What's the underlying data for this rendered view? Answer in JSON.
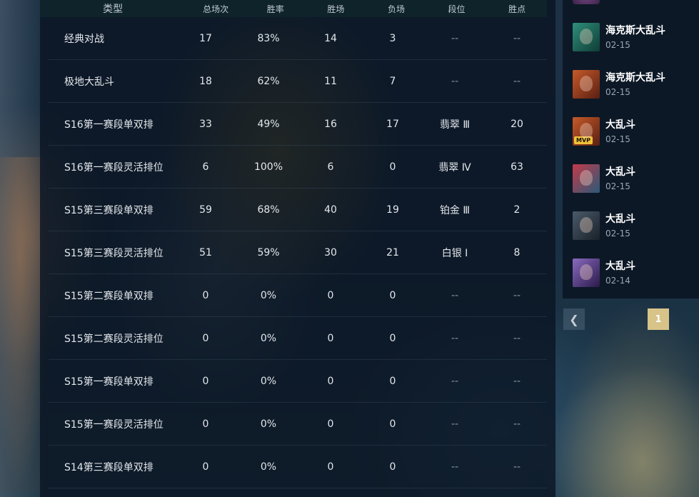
{
  "table": {
    "headers": {
      "type": "类型",
      "total": "总场次",
      "win_rate": "胜率",
      "wins": "胜场",
      "losses": "负场",
      "tier": "段位",
      "lp": "胜点"
    },
    "rows": [
      {
        "type": "经典对战",
        "total": "17",
        "win_rate": "83%",
        "wins": "14",
        "losses": "3",
        "tier": "--",
        "lp": "--"
      },
      {
        "type": "极地大乱斗",
        "total": "18",
        "win_rate": "62%",
        "wins": "11",
        "losses": "7",
        "tier": "--",
        "lp": "--"
      },
      {
        "type": "S16第一赛段单双排",
        "total": "33",
        "win_rate": "49%",
        "wins": "16",
        "losses": "17",
        "tier": "翡翠 Ⅲ",
        "lp": "20"
      },
      {
        "type": "S16第一赛段灵活排位",
        "total": "6",
        "win_rate": "100%",
        "wins": "6",
        "losses": "0",
        "tier": "翡翠 Ⅳ",
        "lp": "63"
      },
      {
        "type": "S15第三赛段单双排",
        "total": "59",
        "win_rate": "68%",
        "wins": "40",
        "losses": "19",
        "tier": "铂金 Ⅲ",
        "lp": "2"
      },
      {
        "type": "S15第三赛段灵活排位",
        "total": "51",
        "win_rate": "59%",
        "wins": "30",
        "losses": "21",
        "tier": "白银 Ⅰ",
        "lp": "8"
      },
      {
        "type": "S15第二赛段单双排",
        "total": "0",
        "win_rate": "0%",
        "wins": "0",
        "losses": "0",
        "tier": "--",
        "lp": "--"
      },
      {
        "type": "S15第二赛段灵活排位",
        "total": "0",
        "win_rate": "0%",
        "wins": "0",
        "losses": "0",
        "tier": "--",
        "lp": "--"
      },
      {
        "type": "S15第一赛段单双排",
        "total": "0",
        "win_rate": "0%",
        "wins": "0",
        "losses": "0",
        "tier": "--",
        "lp": "--"
      },
      {
        "type": "S15第一赛段灵活排位",
        "total": "0",
        "win_rate": "0%",
        "wins": "0",
        "losses": "0",
        "tier": "--",
        "lp": "--"
      },
      {
        "type": "S14第三赛段单双排",
        "total": "0",
        "win_rate": "0%",
        "wins": "0",
        "losses": "0",
        "tier": "--",
        "lp": "--"
      }
    ]
  },
  "recent_matches": [
    {
      "mode": "海克斯大乱斗",
      "date": "02-15",
      "mvp": "",
      "avatar_color": "#2f8f7a",
      "avatar_color2": "#0f3d36"
    },
    {
      "mode": "海克斯大乱斗",
      "date": "02-15",
      "mvp": "",
      "avatar_color": "#c65a2a",
      "avatar_color2": "#5a1f12"
    },
    {
      "mode": "大乱斗",
      "date": "02-15",
      "mvp": "MVP",
      "avatar_color": "#c65a2a",
      "avatar_color2": "#5a1f12"
    },
    {
      "mode": "大乱斗",
      "date": "02-15",
      "mvp": "",
      "avatar_color": "#c43a4a",
      "avatar_color2": "#2a5a78"
    },
    {
      "mode": "大乱斗",
      "date": "02-15",
      "mvp": "",
      "avatar_color": "#4a5a6a",
      "avatar_color2": "#1a222a"
    },
    {
      "mode": "大乱斗",
      "date": "02-14",
      "mvp": "",
      "avatar_color": "#8a6ac0",
      "avatar_color2": "#2a1a4a"
    }
  ],
  "pagination": {
    "prev_icon": "chevron-left-icon",
    "current_page": "1"
  },
  "colors": {
    "page_active": "#d8c489",
    "panel_bg": "#0a1422",
    "header_bg": "#0e242a"
  }
}
